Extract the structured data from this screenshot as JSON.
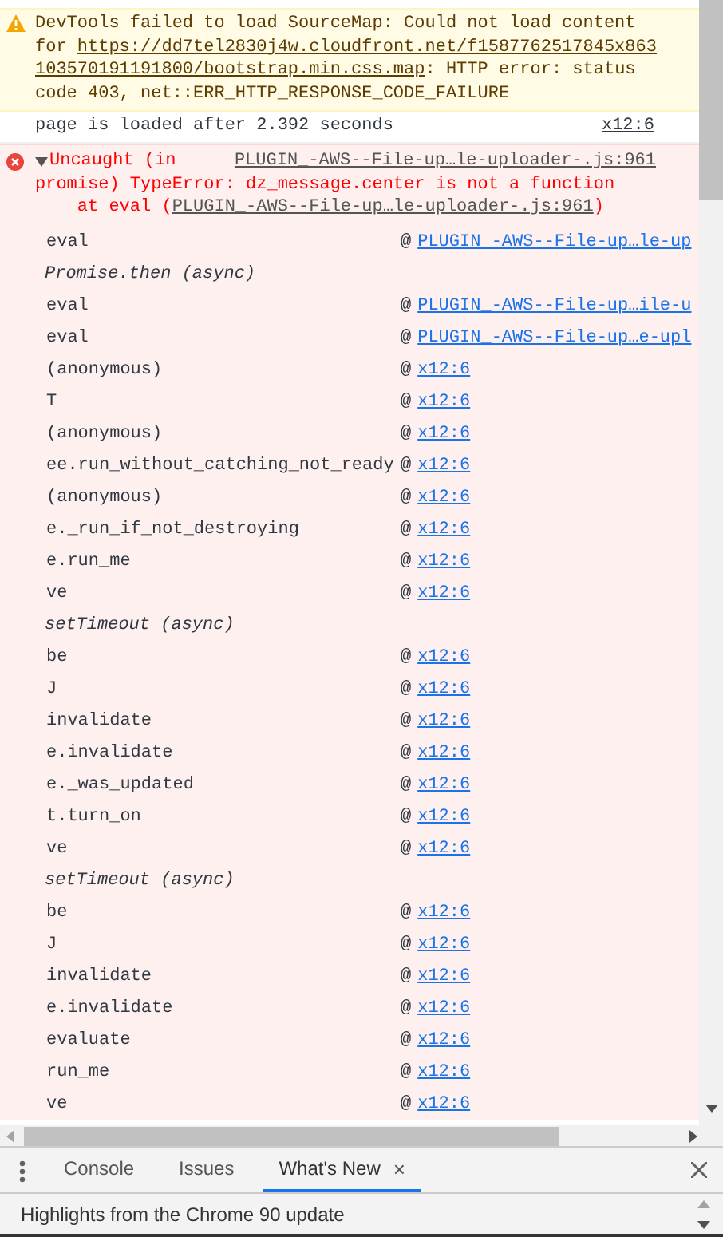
{
  "console": {
    "warning": {
      "lines": [
        [
          {
            "kind": "text",
            "text": "DevTools failed to load SourceMap: Could not load content"
          }
        ],
        [
          {
            "kind": "text",
            "text": "for "
          },
          {
            "kind": "link",
            "text": "https://dd7tel2830j4w.cloudfront.net/f1587762517845x863"
          }
        ],
        [
          {
            "kind": "link",
            "text": "103570191191800/bootstrap.min.css.map"
          },
          {
            "kind": "text",
            "text": ": HTTP error: status"
          }
        ],
        [
          {
            "kind": "text",
            "text": "code 403, net::ERR_HTTP_RESPONSE_CODE_FAILURE"
          }
        ]
      ]
    },
    "log": {
      "message": "page is loaded after 2.392 seconds",
      "source": "x12:6"
    },
    "error": {
      "expanded": true,
      "message_lines": [
        "Uncaught (in",
        "promise) TypeError: dz_message.center is not a function"
      ],
      "source": "PLUGIN_-AWS--File-up…le-uploader-.js:961",
      "at_text": "at eval (",
      "at_link": "PLUGIN_-AWS--File-up…le-uploader-.js:961",
      "at_suffix": ")",
      "frames": [
        {
          "kind": "frame",
          "name": "eval",
          "at": "@",
          "source": "PLUGIN_-AWS--File-up…le-up"
        },
        {
          "kind": "async",
          "name": "Promise.then (async)"
        },
        {
          "kind": "frame",
          "name": "eval",
          "at": "@",
          "source": "PLUGIN_-AWS--File-up…ile-u"
        },
        {
          "kind": "frame",
          "name": "eval",
          "at": "@",
          "source": "PLUGIN_-AWS--File-up…e-upl"
        },
        {
          "kind": "frame",
          "name": "(anonymous)",
          "at": "@",
          "source": "x12:6"
        },
        {
          "kind": "frame",
          "name": "T",
          "at": "@",
          "source": "x12:6"
        },
        {
          "kind": "frame",
          "name": "(anonymous)",
          "at": "@",
          "source": "x12:6"
        },
        {
          "kind": "frame",
          "name": "ee.run_without_catching_not_ready",
          "at": "@",
          "source": "x12:6"
        },
        {
          "kind": "frame",
          "name": "(anonymous)",
          "at": "@",
          "source": "x12:6"
        },
        {
          "kind": "frame",
          "name": "e._run_if_not_destroying",
          "at": "@",
          "source": "x12:6"
        },
        {
          "kind": "frame",
          "name": "e.run_me",
          "at": "@",
          "source": "x12:6"
        },
        {
          "kind": "frame",
          "name": "ve",
          "at": "@",
          "source": "x12:6"
        },
        {
          "kind": "async",
          "name": "setTimeout (async)"
        },
        {
          "kind": "frame",
          "name": "be",
          "at": "@",
          "source": "x12:6"
        },
        {
          "kind": "frame",
          "name": "J",
          "at": "@",
          "source": "x12:6"
        },
        {
          "kind": "frame",
          "name": "invalidate",
          "at": "@",
          "source": "x12:6"
        },
        {
          "kind": "frame",
          "name": "e.invalidate",
          "at": "@",
          "source": "x12:6"
        },
        {
          "kind": "frame",
          "name": "e._was_updated",
          "at": "@",
          "source": "x12:6"
        },
        {
          "kind": "frame",
          "name": "t.turn_on",
          "at": "@",
          "source": "x12:6"
        },
        {
          "kind": "frame",
          "name": "ve",
          "at": "@",
          "source": "x12:6"
        },
        {
          "kind": "async",
          "name": "setTimeout (async)"
        },
        {
          "kind": "frame",
          "name": "be",
          "at": "@",
          "source": "x12:6"
        },
        {
          "kind": "frame",
          "name": "J",
          "at": "@",
          "source": "x12:6"
        },
        {
          "kind": "frame",
          "name": "invalidate",
          "at": "@",
          "source": "x12:6"
        },
        {
          "kind": "frame",
          "name": "e.invalidate",
          "at": "@",
          "source": "x12:6"
        },
        {
          "kind": "frame",
          "name": "evaluate",
          "at": "@",
          "source": "x12:6"
        },
        {
          "kind": "frame",
          "name": "run_me",
          "at": "@",
          "source": "x12:6"
        },
        {
          "kind": "frame",
          "name": "ve",
          "at": "@",
          "source": "x12:6"
        }
      ]
    }
  },
  "drawer": {
    "tabs": [
      {
        "label": "Console",
        "selected": false,
        "closable": false
      },
      {
        "label": "Issues",
        "selected": false,
        "closable": false
      },
      {
        "label": "What's New",
        "selected": true,
        "closable": true,
        "close": "×"
      }
    ],
    "content": "Highlights from the Chrome 90 update"
  }
}
